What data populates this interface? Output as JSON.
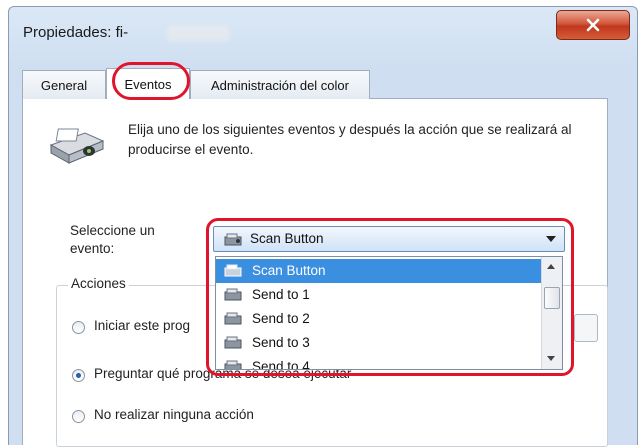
{
  "window": {
    "title": "Propiedades: fi-"
  },
  "tabs": [
    {
      "label": "General"
    },
    {
      "label": "Eventos"
    },
    {
      "label": "Administración del color"
    }
  ],
  "description": "Elija uno de los siguientes eventos y después la acción que se realizará al producirse el evento.",
  "event_selector": {
    "label": "Seleccione un evento:",
    "selected": "Scan Button",
    "options": [
      "Scan Button",
      "Send to 1",
      "Send to 2",
      "Send to 3",
      "Send to 4"
    ]
  },
  "actions": {
    "legend": "Acciones",
    "options": [
      {
        "label": "Iniciar este prog",
        "checked": false
      },
      {
        "label": "Preguntar qué programa se desea ejecutar",
        "checked": true
      },
      {
        "label": "No realizar ninguna acción",
        "checked": false
      }
    ]
  },
  "colors": {
    "highlight": "#e0152b",
    "selection": "#3b8fe0"
  }
}
